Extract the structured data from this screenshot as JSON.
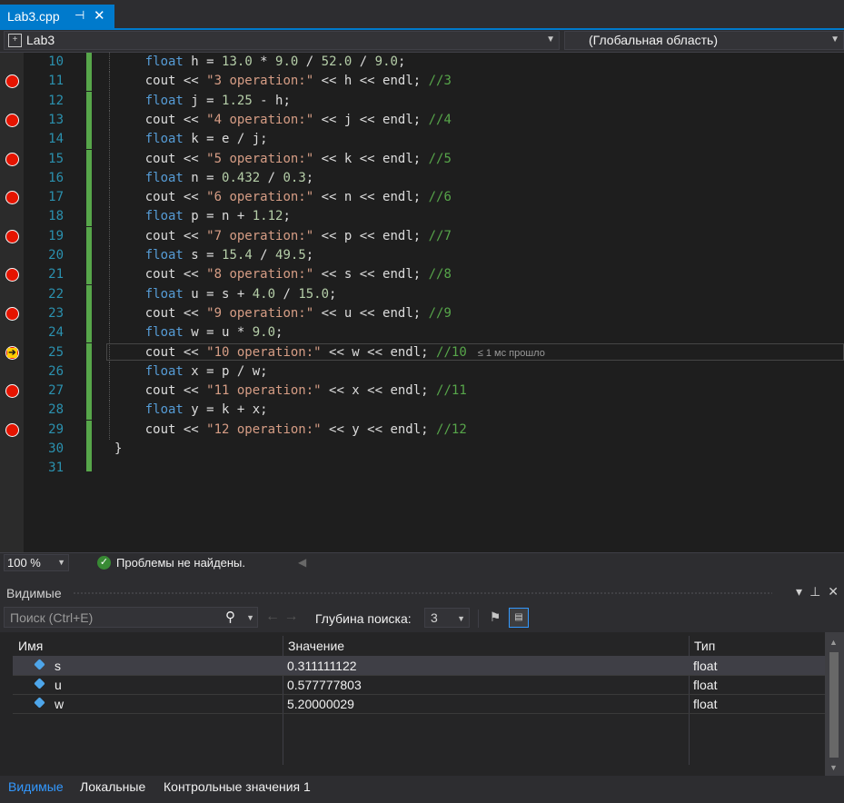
{
  "tab": {
    "file_name": "Lab3.cpp",
    "pin_icon": "pin-icon",
    "close_icon": "close-icon"
  },
  "navbar": {
    "project": "Lab3",
    "scope": "(Глобальная область)"
  },
  "editor": {
    "current_line": 25,
    "lines": [
      {
        "num": "10",
        "bp": false,
        "html": "    <span class='kw'>float</span> h = <span class='num'>13.0</span> * <span class='num'>9.0</span> / <span class='num'>52.0</span> / <span class='num'>9.0</span>;"
      },
      {
        "num": "11",
        "bp": true,
        "html": "    cout &lt;&lt; <span class='str'>\"3 operation:\"</span> &lt;&lt; h &lt;&lt; endl; <span class='cmt'>//3</span>"
      },
      {
        "num": "12",
        "bp": false,
        "html": "    <span class='kw'>float</span> j = <span class='num'>1.25</span> - h;"
      },
      {
        "num": "13",
        "bp": true,
        "html": "    cout &lt;&lt; <span class='str'>\"4 operation:\"</span> &lt;&lt; j &lt;&lt; endl; <span class='cmt'>//4</span>"
      },
      {
        "num": "14",
        "bp": false,
        "html": "    <span class='kw'>float</span> k = e / j;"
      },
      {
        "num": "15",
        "bp": true,
        "html": "    cout &lt;&lt; <span class='str'>\"5 operation:\"</span> &lt;&lt; k &lt;&lt; endl; <span class='cmt'>//5</span>"
      },
      {
        "num": "16",
        "bp": false,
        "html": "    <span class='kw'>float</span> n = <span class='num'>0.432</span> / <span class='num'>0.3</span>;"
      },
      {
        "num": "17",
        "bp": true,
        "html": "    cout &lt;&lt; <span class='str'>\"6 operation:\"</span> &lt;&lt; n &lt;&lt; endl; <span class='cmt'>//6</span>"
      },
      {
        "num": "18",
        "bp": false,
        "html": "    <span class='kw'>float</span> p = n + <span class='num'>1.12</span>;"
      },
      {
        "num": "19",
        "bp": true,
        "html": "    cout &lt;&lt; <span class='str'>\"7 operation:\"</span> &lt;&lt; p &lt;&lt; endl; <span class='cmt'>//7</span>"
      },
      {
        "num": "20",
        "bp": false,
        "html": "    <span class='kw'>float</span> s = <span class='num'>15.4</span> / <span class='num'>49.5</span>;"
      },
      {
        "num": "21",
        "bp": true,
        "html": "    cout &lt;&lt; <span class='str'>\"8 operation:\"</span> &lt;&lt; s &lt;&lt; endl; <span class='cmt'>//8</span>"
      },
      {
        "num": "22",
        "bp": false,
        "html": "    <span class='kw'>float</span> u = s + <span class='num'>4.0</span> / <span class='num'>15.0</span>;"
      },
      {
        "num": "23",
        "bp": true,
        "html": "    cout &lt;&lt; <span class='str'>\"9 operation:\"</span> &lt;&lt; u &lt;&lt; endl; <span class='cmt'>//9</span>"
      },
      {
        "num": "24",
        "bp": false,
        "html": "    <span class='kw'>float</span> w = u * <span class='num'>9.0</span>;"
      },
      {
        "num": "25",
        "bp": "current",
        "html": "    cout &lt;&lt; <span class='str'>\"10 operation:\"</span> &lt;&lt; w &lt;&lt; endl; <span class='cmt'>//10</span><span class='perftip'>≤ 1 мс прошло</span>"
      },
      {
        "num": "26",
        "bp": false,
        "html": "    <span class='kw'>float</span> x = p / w;"
      },
      {
        "num": "27",
        "bp": true,
        "html": "    cout &lt;&lt; <span class='str'>\"11 operation:\"</span> &lt;&lt; x &lt;&lt; endl; <span class='cmt'>//11</span>"
      },
      {
        "num": "28",
        "bp": false,
        "html": "    <span class='kw'>float</span> y = k + x;"
      },
      {
        "num": "29",
        "bp": true,
        "html": "    cout &lt;&lt; <span class='str'>\"12 operation:\"</span> &lt;&lt; y &lt;&lt; endl; <span class='cmt'>//12</span>"
      },
      {
        "num": "30",
        "bp": false,
        "html": "}"
      },
      {
        "num": "31",
        "bp": false,
        "html": ""
      }
    ]
  },
  "status": {
    "zoom": "100 %",
    "message": "Проблемы не найдены."
  },
  "watch": {
    "title": "Видимые",
    "search_placeholder": "Поиск (Ctrl+E)",
    "depth_label": "Глубина поиска:",
    "depth_value": "3",
    "columns": [
      "Имя",
      "Значение",
      "Тип"
    ],
    "rows": [
      {
        "name": "s",
        "value": "0.311111122",
        "type": "float"
      },
      {
        "name": "u",
        "value": "0.577777803",
        "type": "float"
      },
      {
        "name": "w",
        "value": "5.20000029",
        "type": "float"
      }
    ],
    "tabs": [
      "Видимые",
      "Локальные",
      "Контрольные значения 1"
    ]
  }
}
